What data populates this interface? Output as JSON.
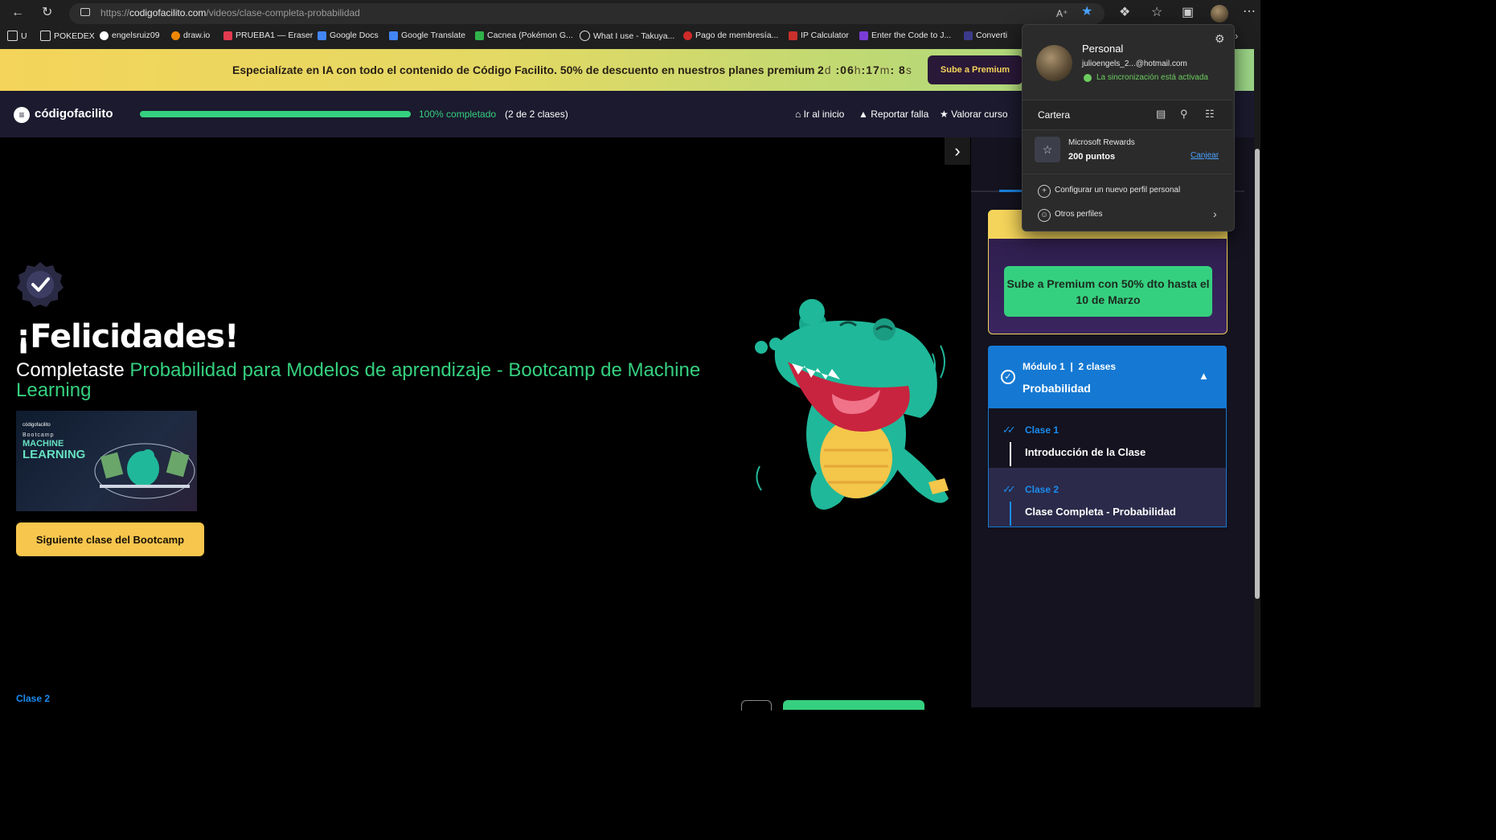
{
  "browser": {
    "url_prefix": "https://",
    "url_host": "codigofacilito.com",
    "url_path": "/videos/clase-completa-probabilidad",
    "bookmarks": [
      "U",
      "POKEDEX",
      "engelsruiz09",
      "draw.io",
      "PRUEBA1 — Eraser",
      "Google Docs",
      "Google Translate",
      "Cacnea (Pokémon G...",
      "What I use - Takuya...",
      "Pago de membresía...",
      "IP Calculator",
      "Enter the Code to J...",
      "Converti"
    ]
  },
  "promo": {
    "text": "Especialízate en IA con todo el contenido de Código Facilito. 50% de descuento en nuestros planes premium",
    "days": "2",
    "days_unit": "d",
    "hours": "06",
    "hours_unit": "h",
    "minutes": "17",
    "minutes_unit": "m",
    "seconds": "8",
    "seconds_unit": "s",
    "button": "Sube a Premium"
  },
  "nav": {
    "logo": "códigofacilito",
    "progress_percent": 100,
    "progress_label": "100% completado",
    "progress_count": "(2 de 2 clases)",
    "home": "Ir al inicio",
    "report": "Reportar falla",
    "rate": "Valorar curso"
  },
  "video": {
    "headline": "¡Felicidades!",
    "completed_prefix": "Completaste",
    "course_name": "Probabilidad para Modelos de aprendizaje - Bootcamp de Machine Learning",
    "thumb_logo": "códigofacilito",
    "thumb_bootcamp": "Bootcamp",
    "thumb_machine": "MACHINE",
    "thumb_learning": "LEARNING",
    "next_button": "Siguiente clase del Bootcamp"
  },
  "sidebar": {
    "premium_button": "Sube a Premium con 50% dto hasta el 10 de Marzo",
    "module_label": "Módulo 1",
    "module_classes": "2 clases",
    "module_title": "Probabilidad",
    "lessons": [
      {
        "num": "Clase 1",
        "title": "Introducción de la Clase"
      },
      {
        "num": "Clase 2",
        "title": "Clase Completa - Probabilidad"
      }
    ]
  },
  "bottom": {
    "clase": "Clase 2"
  },
  "profile": {
    "name": "Personal",
    "email": "julioengels_2...@hotmail.com",
    "sync": "La sincronización está activada",
    "wallet": "Cartera",
    "rewards_label": "Microsoft Rewards",
    "rewards_points": "200 puntos",
    "redeem": "Canjear",
    "new_profile": "Configurar un nuevo perfil personal",
    "other_profiles": "Otros perfiles"
  },
  "colors": {
    "accent_green": "#35d07f",
    "accent_blue": "#1579d3",
    "accent_yellow": "#f6c64d",
    "nav_bg": "#1b1a2e"
  }
}
